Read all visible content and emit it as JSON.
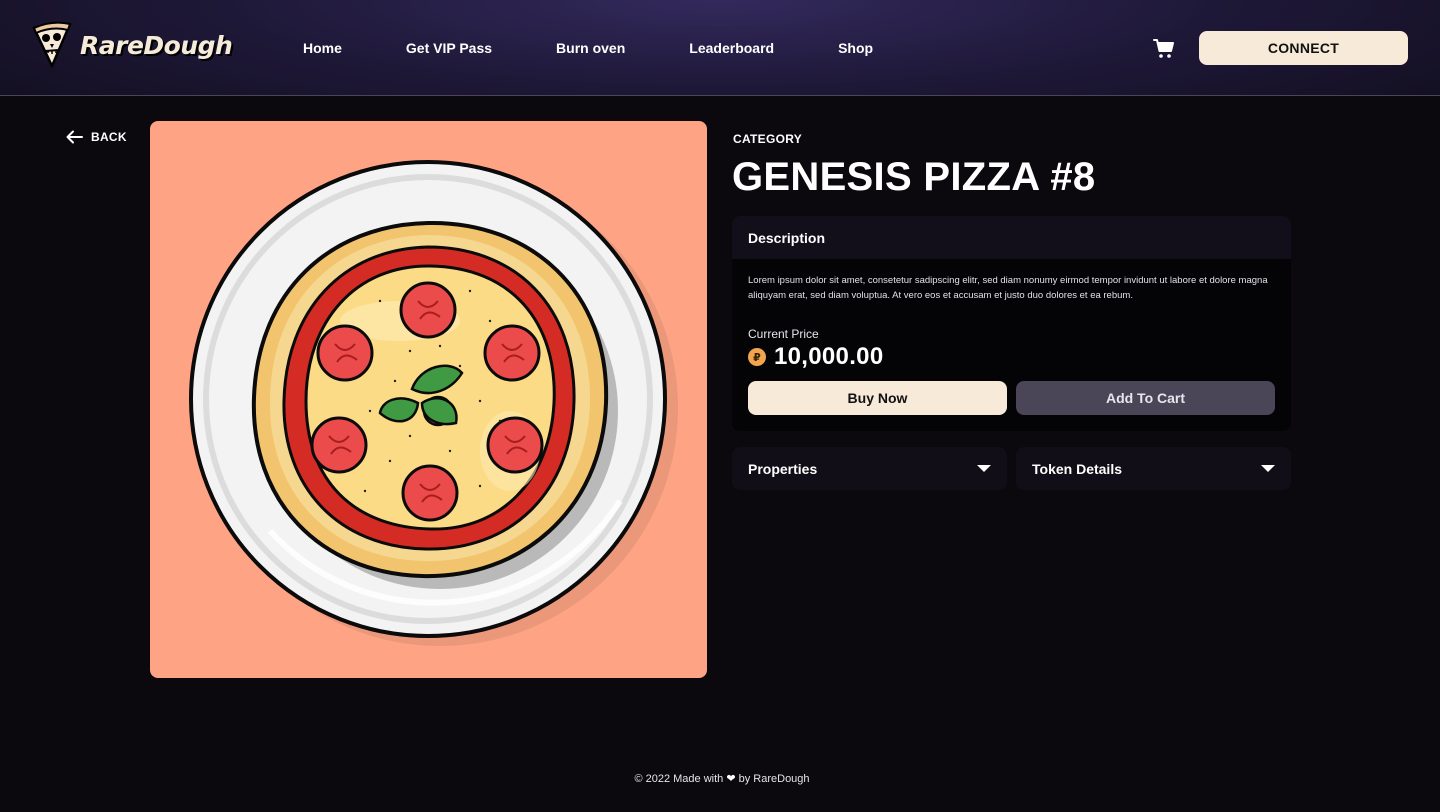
{
  "header": {
    "brand": "RareDough",
    "nav": [
      "Home",
      "Get VIP Pass",
      "Burn oven",
      "Leaderboard",
      "Shop"
    ],
    "cart_icon": "shopping-cart-icon",
    "connect_label": "CONNECT"
  },
  "back_label": "BACK",
  "product": {
    "category": "CATEGORY",
    "title": "GENESIS PIZZA #8",
    "description_heading": "Description",
    "description": "Lorem ipsum dolor sit amet, consetetur sadipscing elitr, sed diam nonumy eirmod tempor invidunt ut labore et dolore magna aliquyam erat, sed diam voluptua. At vero eos et accusam et justo duo dolores et ea rebum.",
    "price_label": "Current Price",
    "price": "10,000.00",
    "coin_icon": "dough-coin-icon",
    "buy_label": "Buy Now",
    "add_cart_label": "Add To Cart",
    "properties_label": "Properties",
    "token_details_label": "Token Details"
  },
  "colors": {
    "accent": "#f8ead8",
    "art_background": "#fea485",
    "secondary_button": "#4a4658"
  },
  "footer": {
    "prefix": "© 2022 Made with",
    "heart": "❤",
    "suffix": "by RareDough"
  }
}
